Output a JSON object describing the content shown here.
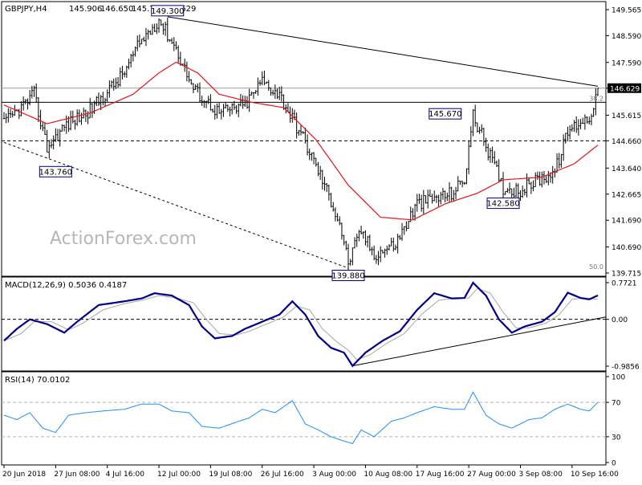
{
  "header": {
    "symbol": "GBPJPY,H4",
    "open": "145.906",
    "high": "146.650",
    "low": "145.759",
    "close": "146.629"
  },
  "watermark": "ActionForex.com",
  "colors": {
    "price_bar": "#000000",
    "moving_average": "#e4141b",
    "macd_line": "#00008b",
    "macd_signal": "#a6a6a6",
    "rsi_line": "#1e90ff",
    "current_price_tag_bg": "#000000"
  },
  "chart_data": [
    {
      "type": "ohlc",
      "panel": "price",
      "ylim": [
        139.715,
        149.565
      ],
      "yticks": [
        "149.565",
        "148.590",
        "147.590",
        "146.629",
        "145.615",
        "144.660",
        "143.640",
        "142.665",
        "141.690",
        "140.690",
        "139.715"
      ],
      "xticks": [
        "20 Jun 2018",
        "27 Jun 08:00",
        "4 Jul 16:00",
        "12 Jul 00:00",
        "19 Jul 08:00",
        "26 Jul 16:00",
        "3 Aug 00:00",
        "10 Aug 08:00",
        "17 Aug 16:00",
        "27 Aug 00:00",
        "3 Sep 08:00",
        "10 Sep 16:00"
      ],
      "close_anchors": [
        [
          0,
          145.3
        ],
        [
          8,
          145.9
        ],
        [
          14,
          146.4
        ],
        [
          20,
          144.4
        ],
        [
          28,
          145.2
        ],
        [
          40,
          145.8
        ],
        [
          55,
          147.1
        ],
        [
          63,
          148.3
        ],
        [
          72,
          149.2
        ],
        [
          80,
          148.1
        ],
        [
          88,
          146.6
        ],
        [
          100,
          145.7
        ],
        [
          112,
          146.0
        ],
        [
          120,
          146.9
        ],
        [
          128,
          146.4
        ],
        [
          140,
          144.6
        ],
        [
          148,
          143.2
        ],
        [
          156,
          141.6
        ],
        [
          160,
          140.1
        ],
        [
          166,
          141.3
        ],
        [
          172,
          140.4
        ],
        [
          182,
          140.8
        ],
        [
          192,
          142.3
        ],
        [
          208,
          142.7
        ],
        [
          214,
          143.2
        ],
        [
          218,
          145.6
        ],
        [
          224,
          144.5
        ],
        [
          232,
          142.9
        ],
        [
          240,
          142.8
        ],
        [
          248,
          143.2
        ],
        [
          256,
          143.5
        ],
        [
          262,
          145.0
        ],
        [
          268,
          145.4
        ],
        [
          272,
          145.5
        ],
        [
          276,
          146.63
        ]
      ],
      "moving_average": [
        [
          0,
          146.0
        ],
        [
          20,
          145.3
        ],
        [
          40,
          145.7
        ],
        [
          60,
          146.4
        ],
        [
          72,
          147.2
        ],
        [
          80,
          147.6
        ],
        [
          90,
          147.2
        ],
        [
          100,
          146.4
        ],
        [
          115,
          146.1
        ],
        [
          130,
          145.9
        ],
        [
          145,
          144.7
        ],
        [
          160,
          143.0
        ],
        [
          175,
          141.8
        ],
        [
          190,
          141.7
        ],
        [
          205,
          142.3
        ],
        [
          220,
          142.7
        ],
        [
          232,
          143.2
        ],
        [
          250,
          143.3
        ],
        [
          265,
          143.8
        ],
        [
          276,
          144.5
        ]
      ],
      "levels": [
        {
          "label": "146.629",
          "value": 146.629,
          "style": "current-price"
        },
        {
          "label": "146.100",
          "value": 146.1,
          "style": "solid"
        },
        {
          "label": "144.660",
          "value": 144.66,
          "style": "dashed"
        }
      ],
      "trendlines": [
        {
          "from": [
            76,
            149.3
          ],
          "to": [
            276,
            146.7
          ],
          "style": "solid"
        },
        {
          "from": [
            0,
            144.6
          ],
          "to": [
            160,
            139.9
          ],
          "style": "dashed"
        }
      ],
      "price_labels": [
        {
          "text": "149.300",
          "x": 76,
          "y": 149.3,
          "position": "above"
        },
        {
          "text": "143.760",
          "x": 24,
          "y": 143.76,
          "position": "below"
        },
        {
          "text": "139.880",
          "x": 160,
          "y": 139.88,
          "position": "below"
        },
        {
          "text": "145.670",
          "x": 214,
          "y": 145.67,
          "position": "left"
        },
        {
          "text": "142.580",
          "x": 232,
          "y": 142.58,
          "position": "below"
        }
      ],
      "fib_labels": [
        {
          "text": "38.2",
          "value": 146.1
        },
        {
          "text": "50.0",
          "value": 139.8
        }
      ]
    },
    {
      "type": "macd",
      "panel": "macd",
      "title": "MACD(12,26,9) 0.5036 0.4187",
      "ylim": [
        -0.9856,
        0.7721
      ],
      "yticks": [
        "0.7721",
        "0.00",
        "-0.9856"
      ],
      "main_line": [
        [
          0,
          -0.45
        ],
        [
          6,
          -0.2
        ],
        [
          12,
          0.0
        ],
        [
          20,
          -0.1
        ],
        [
          28,
          -0.28
        ],
        [
          34,
          -0.05
        ],
        [
          44,
          0.3
        ],
        [
          56,
          0.38
        ],
        [
          64,
          0.44
        ],
        [
          70,
          0.55
        ],
        [
          78,
          0.5
        ],
        [
          86,
          0.3
        ],
        [
          92,
          -0.15
        ],
        [
          98,
          -0.4
        ],
        [
          106,
          -0.35
        ],
        [
          112,
          -0.2
        ],
        [
          120,
          -0.05
        ],
        [
          128,
          0.1
        ],
        [
          134,
          0.38
        ],
        [
          140,
          0.1
        ],
        [
          146,
          -0.35
        ],
        [
          152,
          -0.6
        ],
        [
          158,
          -0.7
        ],
        [
          162,
          -0.98
        ],
        [
          168,
          -0.7
        ],
        [
          176,
          -0.45
        ],
        [
          184,
          -0.25
        ],
        [
          192,
          0.2
        ],
        [
          200,
          0.55
        ],
        [
          208,
          0.44
        ],
        [
          214,
          0.45
        ],
        [
          218,
          0.77
        ],
        [
          224,
          0.5
        ],
        [
          230,
          0.0
        ],
        [
          236,
          -0.28
        ],
        [
          242,
          -0.15
        ],
        [
          250,
          -0.05
        ],
        [
          256,
          0.15
        ],
        [
          262,
          0.56
        ],
        [
          268,
          0.45
        ],
        [
          272,
          0.42
        ],
        [
          276,
          0.5036
        ]
      ],
      "signal_line": [
        [
          0,
          -0.45
        ],
        [
          8,
          -0.3
        ],
        [
          14,
          -0.05
        ],
        [
          22,
          -0.05
        ],
        [
          30,
          -0.22
        ],
        [
          36,
          -0.1
        ],
        [
          46,
          0.2
        ],
        [
          56,
          0.33
        ],
        [
          64,
          0.4
        ],
        [
          72,
          0.5
        ],
        [
          80,
          0.45
        ],
        [
          88,
          0.35
        ],
        [
          94,
          0.0
        ],
        [
          100,
          -0.3
        ],
        [
          108,
          -0.33
        ],
        [
          114,
          -0.25
        ],
        [
          122,
          -0.1
        ],
        [
          130,
          0.05
        ],
        [
          136,
          0.28
        ],
        [
          142,
          0.2
        ],
        [
          148,
          -0.2
        ],
        [
          154,
          -0.45
        ],
        [
          160,
          -0.65
        ],
        [
          164,
          -0.85
        ],
        [
          170,
          -0.75
        ],
        [
          178,
          -0.5
        ],
        [
          186,
          -0.3
        ],
        [
          194,
          0.1
        ],
        [
          202,
          0.4
        ],
        [
          210,
          0.45
        ],
        [
          216,
          0.45
        ],
        [
          220,
          0.65
        ],
        [
          226,
          0.55
        ],
        [
          232,
          0.15
        ],
        [
          238,
          -0.18
        ],
        [
          244,
          -0.18
        ],
        [
          252,
          -0.08
        ],
        [
          258,
          0.1
        ],
        [
          264,
          0.42
        ],
        [
          270,
          0.45
        ],
        [
          276,
          0.4187
        ]
      ],
      "trendline": {
        "from": [
          162,
          -0.98
        ],
        "to": [
          276,
          0.02
        ]
      }
    },
    {
      "type": "rsi",
      "panel": "rsi",
      "title": "RSI(14) 70.0102",
      "ylim": [
        0,
        100
      ],
      "yticks": [
        "100",
        "70",
        "30",
        "0"
      ],
      "levels": [
        70,
        30
      ],
      "line": [
        [
          0,
          55
        ],
        [
          6,
          50
        ],
        [
          12,
          58
        ],
        [
          18,
          40
        ],
        [
          24,
          35
        ],
        [
          30,
          55
        ],
        [
          38,
          58
        ],
        [
          46,
          60
        ],
        [
          56,
          62
        ],
        [
          64,
          68
        ],
        [
          72,
          68
        ],
        [
          78,
          60
        ],
        [
          86,
          58
        ],
        [
          92,
          42
        ],
        [
          100,
          40
        ],
        [
          108,
          47
        ],
        [
          114,
          52
        ],
        [
          120,
          62
        ],
        [
          126,
          58
        ],
        [
          134,
          72
        ],
        [
          140,
          45
        ],
        [
          146,
          38
        ],
        [
          152,
          30
        ],
        [
          158,
          25
        ],
        [
          162,
          22
        ],
        [
          166,
          38
        ],
        [
          172,
          30
        ],
        [
          180,
          48
        ],
        [
          186,
          52
        ],
        [
          192,
          58
        ],
        [
          200,
          65
        ],
        [
          208,
          62
        ],
        [
          214,
          62
        ],
        [
          218,
          82
        ],
        [
          224,
          55
        ],
        [
          230,
          45
        ],
        [
          236,
          40
        ],
        [
          244,
          50
        ],
        [
          250,
          52
        ],
        [
          256,
          62
        ],
        [
          262,
          68
        ],
        [
          268,
          62
        ],
        [
          272,
          60
        ],
        [
          276,
          70.0102
        ]
      ]
    }
  ]
}
